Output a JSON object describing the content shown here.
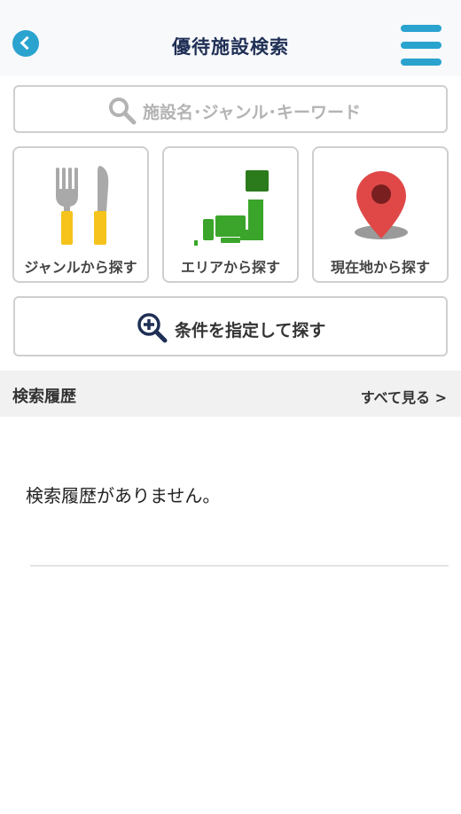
{
  "header": {
    "title": "優待施設検索"
  },
  "search": {
    "placeholder": "施設名･ジャンル･キーワード"
  },
  "categories": [
    {
      "label": "ジャンルから探す",
      "icon": "fork-knife-icon"
    },
    {
      "label": "エリアから探す",
      "icon": "japan-map-icon"
    },
    {
      "label": "現在地から探す",
      "icon": "location-pin-icon"
    }
  ],
  "condition": {
    "label": "条件を指定して探す",
    "icon": "zoom-in-icon"
  },
  "history": {
    "title": "検索履歴",
    "see_all": "すべて見る >",
    "empty_message": "検索履歴がありません。"
  },
  "colors": {
    "accent": "#2aa3cf",
    "title": "#1f2f55",
    "green": "#3aa52a",
    "red": "#e04848",
    "yellow": "#f5c31b"
  }
}
